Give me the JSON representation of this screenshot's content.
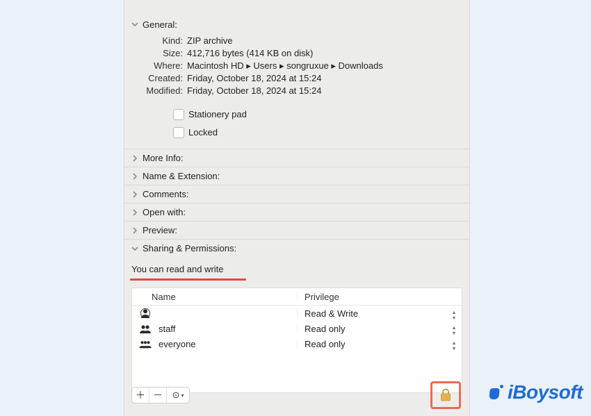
{
  "sections": {
    "general": {
      "label": "General:"
    },
    "more_info": {
      "label": "More Info:"
    },
    "name_ext": {
      "label": "Name & Extension:"
    },
    "comments": {
      "label": "Comments:"
    },
    "open_with": {
      "label": "Open with:"
    },
    "preview": {
      "label": "Preview:"
    },
    "sharing": {
      "label": "Sharing & Permissions:"
    }
  },
  "general": {
    "kind_label": "Kind:",
    "kind_value": "ZIP archive",
    "size_label": "Size:",
    "size_value": "412,716 bytes (414 KB on disk)",
    "where_label": "Where:",
    "where_value": "Macintosh HD ▸ Users ▸ songruxue ▸ Downloads",
    "created_label": "Created:",
    "created_value": "Friday, October 18, 2024 at 15:24",
    "modified_label": "Modified:",
    "modified_value": "Friday, October 18, 2024 at 15:24",
    "stationery_label": "Stationery pad",
    "locked_label": "Locked"
  },
  "sharing": {
    "message": "You can read and write",
    "headers": {
      "name": "Name",
      "privilege": "Privilege"
    },
    "rows": [
      {
        "name": "",
        "privilege": "Read & Write",
        "icon": "user"
      },
      {
        "name": "staff",
        "privilege": "Read only",
        "icon": "group"
      },
      {
        "name": "everyone",
        "privilege": "Read only",
        "icon": "everyone"
      }
    ]
  },
  "brand": "iBoysoft"
}
